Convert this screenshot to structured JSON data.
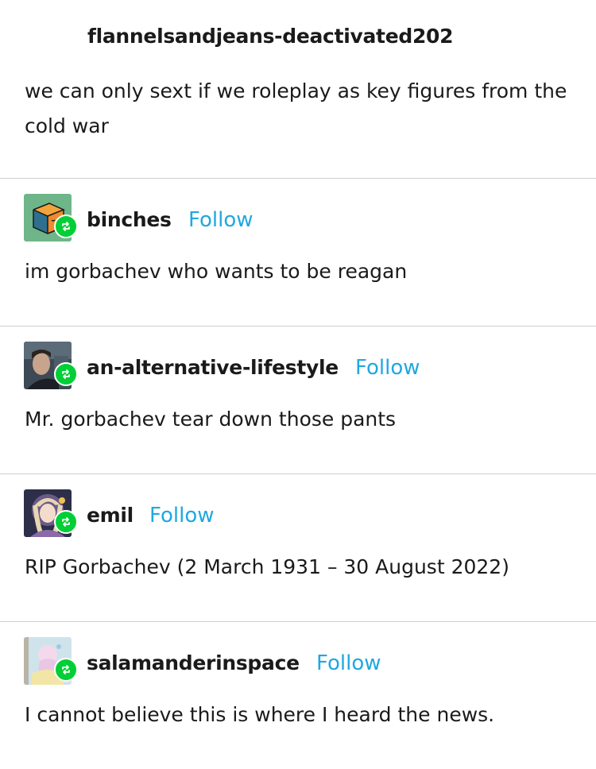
{
  "original_post": {
    "username": "flannelsandjeans-deactivated202",
    "text": "we can only sext if we roleplay as key figures from the cold war"
  },
  "reblogs": [
    {
      "username": "binches",
      "follow_label": "Follow",
      "text": "im gorbachev who wants to be reagan",
      "avatar_icon": "isometric-cube-avatar"
    },
    {
      "username": "an-alternative-lifestyle",
      "follow_label": "Follow",
      "text": "Mr. gorbachev tear down those pants",
      "avatar_icon": "photo-portrait-avatar"
    },
    {
      "username": "emil",
      "follow_label": "Follow",
      "text": "RIP Gorbachev (2 March 1931 – 30 August 2022)",
      "avatar_icon": "anime-portrait-avatar"
    },
    {
      "username": "salamanderinspace",
      "follow_label": "Follow",
      "text": "I cannot believe this is where I heard the news.",
      "avatar_icon": "pastel-painting-avatar"
    }
  ],
  "colors": {
    "follow_link": "#1fa8e0",
    "reblog_badge": "#00cf35",
    "divider": "#cfcfcf",
    "text": "#1a1a1a"
  }
}
